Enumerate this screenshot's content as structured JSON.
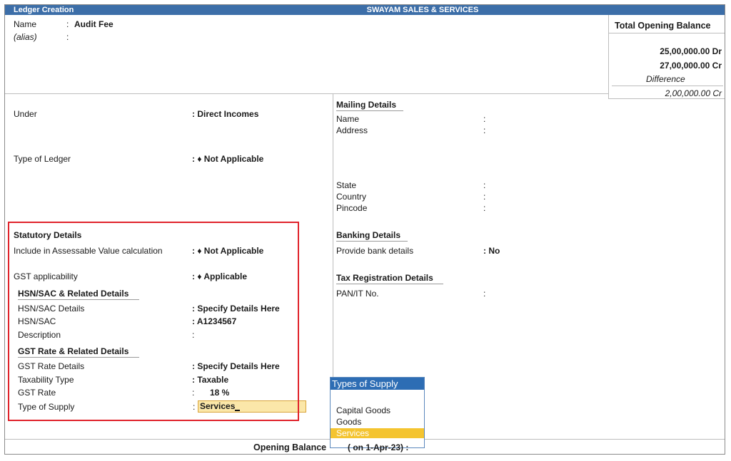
{
  "title_bar": {
    "left": "Ledger Creation",
    "center": "SWAYAM SALES & SERVICES"
  },
  "header": {
    "name_label": "Name",
    "name_value": "Audit Fee",
    "alias_label": "(alias)",
    "sep": ":"
  },
  "total_opening": {
    "title": "Total Opening Balance",
    "dr": "25,00,000.00 Dr",
    "cr": "27,00,000.00 Cr",
    "diff_label": "Difference",
    "diff_value": "2,00,000.00 Cr"
  },
  "left": {
    "under_label": "Under",
    "under_value": ": Direct Incomes",
    "type_label": "Type of Ledger",
    "type_value": ": ♦ Not Applicable"
  },
  "statutory": {
    "title": "Statutory Details",
    "assessable_label": "Include in Assessable Value calculation",
    "assessable_value": ": ♦ Not Applicable",
    "gst_app_label": "GST applicability",
    "gst_app_value": ": ♦ Applicable",
    "hsn_title": "HSN/SAC & Related Details",
    "hsn_details_label": "HSN/SAC Details",
    "hsn_details_value": ": Specify Details Here",
    "hsn_label": "HSN/SAC",
    "hsn_value": ": A1234567",
    "desc_label": "Description",
    "desc_value": ":",
    "gst_title": "GST Rate & Related Details",
    "rate_details_label": "GST Rate Details",
    "rate_details_value": ": Specify Details Here",
    "taxability_label": "Taxability Type",
    "taxability_value": ": Taxable",
    "rate_label": "GST Rate",
    "rate_sep": ":",
    "rate_value": "18 %",
    "supply_label": "Type of Supply",
    "supply_sep": ":",
    "supply_value": "Services"
  },
  "mailing": {
    "title": "Mailing Details",
    "name_label": "Name",
    "address_label": "Address",
    "state_label": "State",
    "country_label": "Country",
    "pincode_label": "Pincode",
    "sep": ":"
  },
  "banking": {
    "title": "Banking Details",
    "bank_label": "Provide bank details",
    "bank_value": ": No"
  },
  "tax": {
    "title": "Tax Registration Details",
    "pan_label": "PAN/IT No.",
    "sep": ":"
  },
  "supply_popup": {
    "title": "Types of Supply",
    "options": [
      "Capital Goods",
      "Goods",
      "Services"
    ],
    "selected": "Services"
  },
  "footer": {
    "label": "Opening Balance",
    "value": "( on 1-Apr-23) :"
  },
  "colors": {
    "title_bar": "#3c6ea8",
    "highlight": "#e0232b",
    "input_bg": "#fbe7a9",
    "selected_option": "#f4c430",
    "popup_header": "#2d6db4"
  }
}
